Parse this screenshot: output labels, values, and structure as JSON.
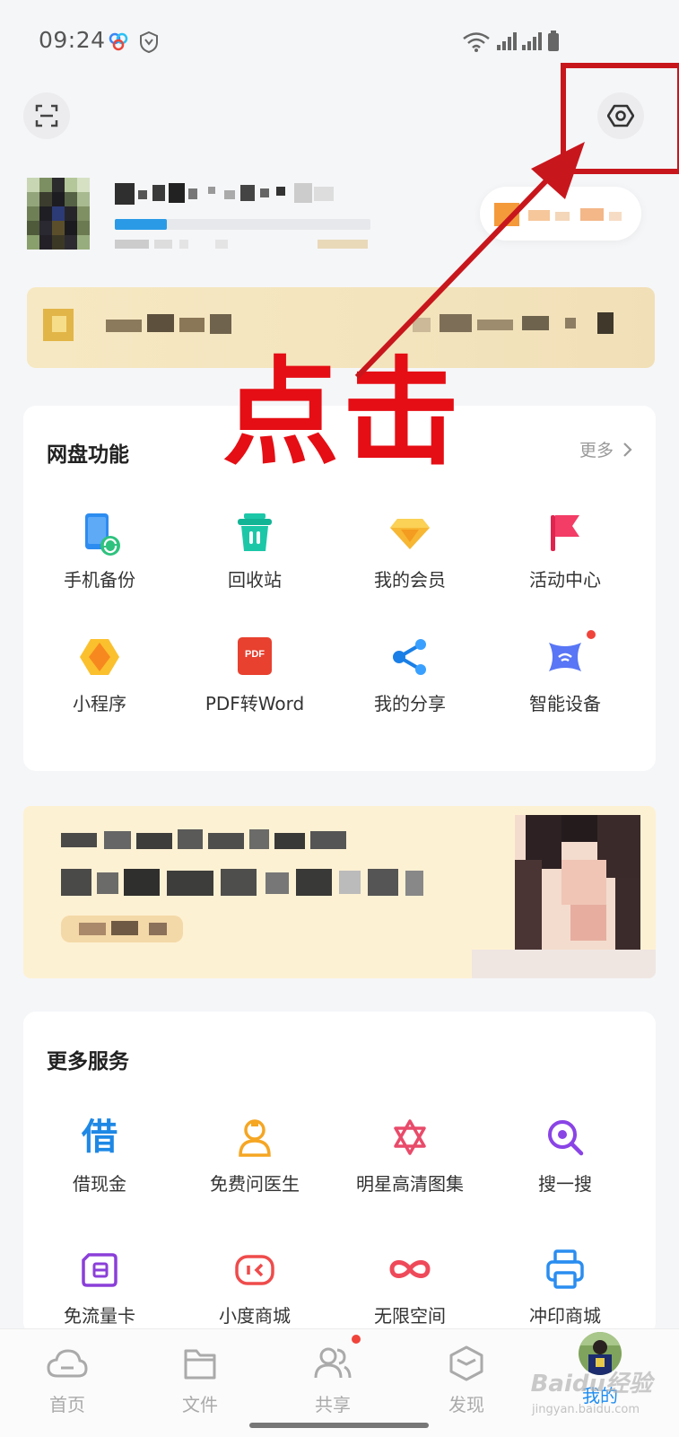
{
  "status_bar": {
    "time": "09:24"
  },
  "annotation": {
    "text": "点击",
    "color": "#e50e14"
  },
  "netdisk_features": {
    "title": "网盘功能",
    "more_label": "更多",
    "items": [
      {
        "label": "手机备份",
        "icon": "phone-backup-icon"
      },
      {
        "label": "回收站",
        "icon": "trash-icon"
      },
      {
        "label": "我的会员",
        "icon": "diamond-icon"
      },
      {
        "label": "活动中心",
        "icon": "flag-icon"
      },
      {
        "label": "小程序",
        "icon": "mini-program-icon"
      },
      {
        "label": "PDF转Word",
        "icon": "pdf-icon",
        "badge_text": "PDF"
      },
      {
        "label": "我的分享",
        "icon": "share-icon"
      },
      {
        "label": "智能设备",
        "icon": "smart-device-icon"
      }
    ]
  },
  "more_services": {
    "title": "更多服务",
    "items": [
      {
        "label": "借现金",
        "icon": "loan-icon",
        "glyph": "借"
      },
      {
        "label": "免费问医生",
        "icon": "doctor-icon"
      },
      {
        "label": "明星高清图集",
        "icon": "star-gallery-icon"
      },
      {
        "label": "搜一搜",
        "icon": "search-icon"
      },
      {
        "label": "免流量卡",
        "icon": "data-card-icon"
      },
      {
        "label": "小度商城",
        "icon": "xiaodu-store-icon"
      },
      {
        "label": "无限空间",
        "icon": "infinity-icon"
      },
      {
        "label": "冲印商城",
        "icon": "print-store-icon"
      }
    ]
  },
  "bottom_nav": {
    "items": [
      {
        "label": "首页",
        "icon": "cloud-icon"
      },
      {
        "label": "文件",
        "icon": "folder-icon"
      },
      {
        "label": "共享",
        "icon": "people-icon"
      },
      {
        "label": "发现",
        "icon": "cube-icon"
      },
      {
        "label": "我的",
        "icon": "profile-avatar",
        "active": true
      }
    ]
  },
  "watermark": {
    "brand": "Baidu经验",
    "url": "jingyan.baidu.com"
  },
  "colors": {
    "accent": "#1e8cf0",
    "annotation_red": "#e50e14",
    "dot_red": "#f0443b"
  }
}
